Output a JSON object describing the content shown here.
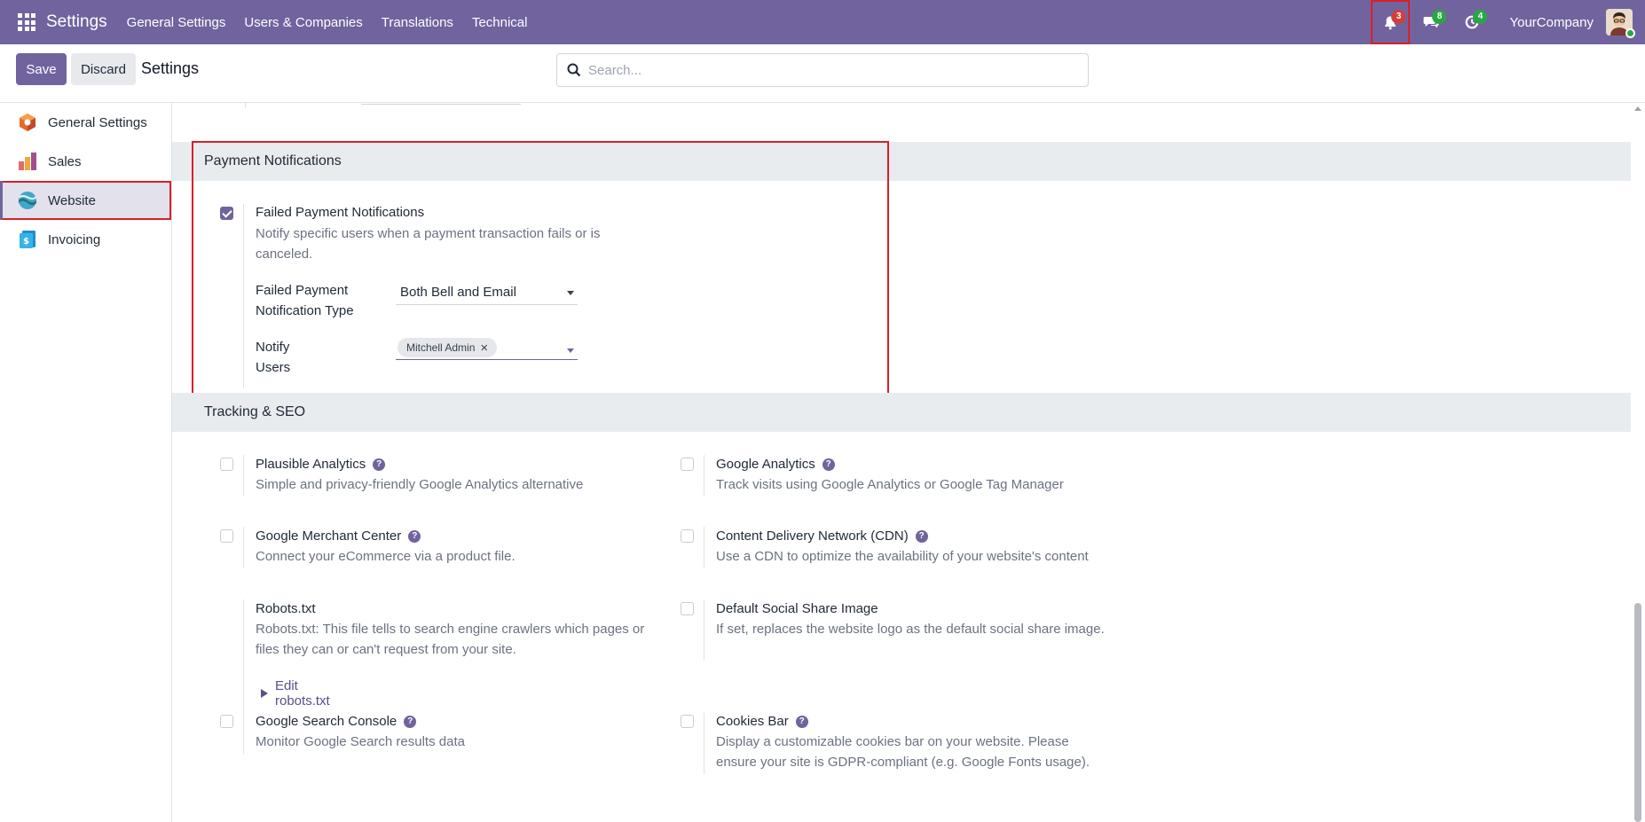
{
  "navbar": {
    "brand": "Settings",
    "menu": [
      "General Settings",
      "Users & Companies",
      "Translations",
      "Technical"
    ],
    "systray": {
      "notifications": {
        "icon": "bell-icon",
        "count": "3",
        "color": "#d23f3a"
      },
      "messages": {
        "icon": "chat-icon",
        "count": "8",
        "color": "#28a745"
      },
      "activities": {
        "icon": "clock-icon",
        "count": "4",
        "color": "#28a745"
      }
    },
    "company": "YourCompany"
  },
  "control_panel": {
    "save_label": "Save",
    "discard_label": "Discard",
    "title": "Settings",
    "search_placeholder": "Search..."
  },
  "sidebar": {
    "items": [
      {
        "label": "General Settings",
        "icon": "general-settings-icon"
      },
      {
        "label": "Sales",
        "icon": "sales-icon"
      },
      {
        "label": "Website",
        "icon": "website-icon",
        "active": true
      },
      {
        "label": "Invoicing",
        "icon": "invoicing-icon"
      }
    ]
  },
  "payment": {
    "section_title": "Payment Notifications",
    "failed": {
      "title": "Failed Payment Notifications",
      "desc": "Notify specific users when a payment transaction fails or is canceled.",
      "checked": true,
      "type_label": "Failed Payment Notification Type",
      "type_value": "Both Bell and Email",
      "users_label": "Notify Users",
      "users": [
        "Mitchell Admin"
      ]
    }
  },
  "tracking": {
    "section_title": "Tracking & SEO",
    "plausible": {
      "title": "Plausible Analytics",
      "desc": "Simple and privacy-friendly Google Analytics alternative",
      "checked": false
    },
    "google_analytics": {
      "title": "Google Analytics",
      "desc": "Track visits using Google Analytics or Google Tag Manager",
      "checked": false
    },
    "merchant": {
      "title": "Google Merchant Center",
      "desc": "Connect your eCommerce via a product file.",
      "checked": false
    },
    "cdn": {
      "title": "Content Delivery Network (CDN)",
      "desc": "Use a CDN to optimize the availability of your website's content",
      "checked": false
    },
    "robots": {
      "title": "Robots.txt",
      "desc": "Robots.txt: This file tells to search engine crawlers which pages or files they can or can't request from your site.",
      "link": "Edit robots.txt"
    },
    "social": {
      "title": "Default Social Share Image",
      "desc": "If set, replaces the website logo as the default social share image.",
      "checked": false
    },
    "search_console": {
      "title": "Google Search Console",
      "desc": "Monitor Google Search results data",
      "checked": false
    },
    "cookies": {
      "title": "Cookies Bar",
      "desc": "Display a customizable cookies bar on your website. Please ensure your site is GDPR-compliant (e.g. Google Fonts usage).",
      "checked": false
    }
  },
  "colors": {
    "brand": "#71639e",
    "highlight": "#d92027",
    "section_bg": "#e9ecef"
  }
}
